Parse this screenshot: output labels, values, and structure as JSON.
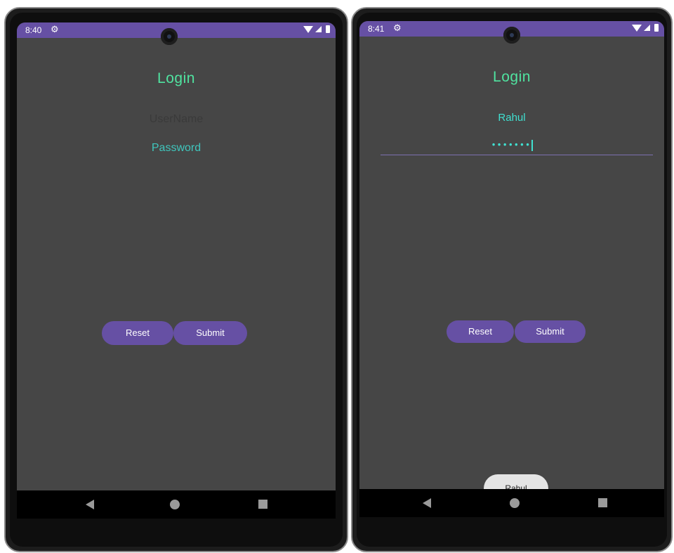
{
  "left_phone": {
    "status_time": "8:40",
    "title": "Login",
    "username_placeholder": "UserName",
    "password_placeholder": "Password",
    "reset_label": "Reset",
    "submit_label": "Submit"
  },
  "right_phone": {
    "status_time": "8:41",
    "title": "Login",
    "username_value": "Rahul",
    "password_value": "•••••••",
    "reset_label": "Reset",
    "submit_label": "Submit",
    "toast_text": "Rahul"
  },
  "icons": {
    "gear": "⚙",
    "back": "triangle-left",
    "home": "circle",
    "recents": "square"
  },
  "colors": {
    "accent": "#6650a4",
    "title": "#50e3a0",
    "text": "#40e0d0",
    "screen_bg": "#464646"
  }
}
